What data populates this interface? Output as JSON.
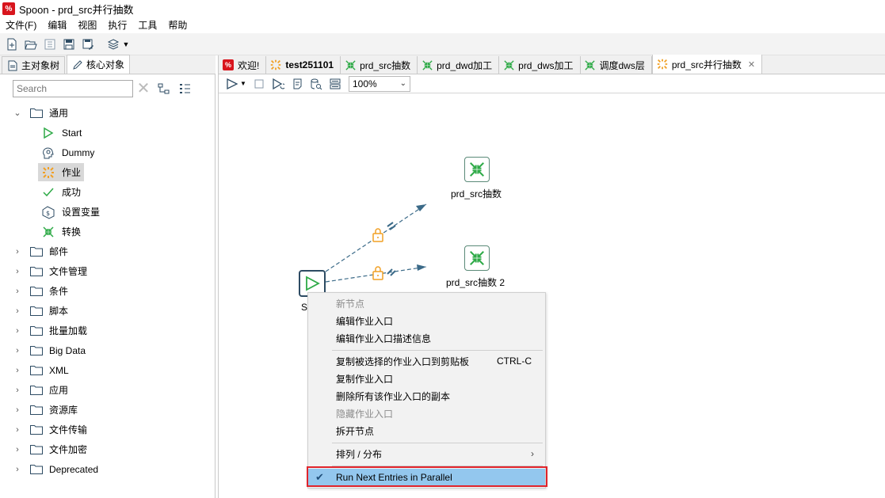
{
  "window": {
    "title": "Spoon - prd_src并行抽数"
  },
  "menu": [
    "文件(F)",
    "编辑",
    "视图",
    "执行",
    "工具",
    "帮助"
  ],
  "left_panel": {
    "tabs": [
      {
        "label": "主对象树",
        "active": false
      },
      {
        "label": "核心对象",
        "active": true
      }
    ],
    "search": {
      "placeholder": "Search"
    },
    "tree": {
      "general": {
        "label": "通用",
        "expanded": true
      },
      "general_children": [
        "Start",
        "Dummy",
        "作业",
        "成功",
        "设置变量",
        "转换"
      ],
      "selected_child": "作业",
      "folders": [
        "邮件",
        "文件管理",
        "条件",
        "脚本",
        "批量加载",
        "Big Data",
        "XML",
        "应用",
        "资源库",
        "文件传输",
        "文件加密",
        "Deprecated"
      ]
    }
  },
  "editor": {
    "tabs": [
      {
        "label": "欢迎!",
        "icon": "spoon-logo-icon"
      },
      {
        "label": "test251101",
        "icon": "job-icon",
        "bold": true
      },
      {
        "label": "prd_src抽数",
        "icon": "transform-icon"
      },
      {
        "label": "prd_dwd加工",
        "icon": "transform-icon"
      },
      {
        "label": "prd_dws加工",
        "icon": "transform-icon"
      },
      {
        "label": "调度dws层",
        "icon": "transform-icon"
      },
      {
        "label": "prd_src并行抽数",
        "icon": "job-icon",
        "active": true
      }
    ],
    "zoom": "100%"
  },
  "canvas": {
    "start_label": "St",
    "node1_label": "prd_src抽数",
    "node2_label": "prd_src抽数 2"
  },
  "context_menu": {
    "new_node": "新节点",
    "edit_entry": "编辑作业入口",
    "edit_desc": "编辑作业入口描述信息",
    "copy_clipboard": "复制被选择的作业入口到剪贴板",
    "copy_shortcut": "CTRL-C",
    "copy_entry": "复制作业入口",
    "delete_copies": "删除所有该作业入口的副本",
    "hide_entry": "隐藏作业入口",
    "detach_node": "拆开节点",
    "arrange": "排列 / 分布",
    "run_parallel": "Run Next Entries in Parallel"
  },
  "colors": {
    "accent_green": "#2eaa47",
    "highlight_red": "#e0242c",
    "checked_bg": "#93c7ee",
    "hop_blue": "#3b6a88",
    "lock_orange": "#f1a025"
  }
}
